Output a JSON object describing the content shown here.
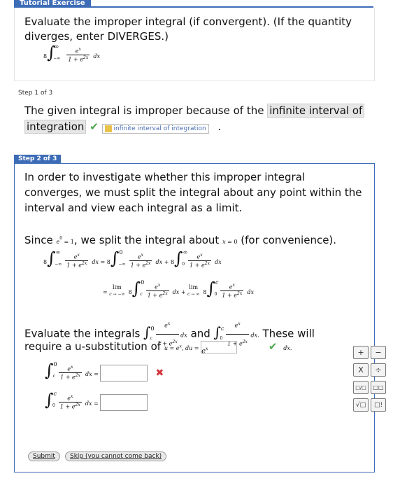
{
  "tutorial": {
    "tab_label": "Tutorial Exercise",
    "question": "Evaluate the improper integral (if convergent). (If the quantity diverges, enter DIVERGES.)"
  },
  "step1": {
    "label": "Step 1 of 3",
    "text_before": "The given integral is improper because of the",
    "answer_highlight_line1": "infinite interval of",
    "answer_highlight_line2": "integration",
    "answer_key": "infinite interval of integration",
    "period": "."
  },
  "step2": {
    "label": "Step 2 of 3",
    "paragraph": "In order to investigate whether this improper integral converges, we must split the integral about any point within the interval and view each integral as a limit.",
    "since_prefix": "Since",
    "since_mid": ", we split the integral about",
    "since_suffix": "(for convenience).",
    "evaluate_prefix": "Evaluate the integrals",
    "and_text": "and",
    "these_will": "These will",
    "require_text": "require a u-substitution of",
    "du_answer": "e",
    "du_suffix": "dx."
  },
  "keypad": [
    "+",
    "−",
    "X",
    "÷",
    "□/□",
    "□□",
    "√□",
    "□!"
  ],
  "buttons": {
    "submit": "Submit",
    "skip": "Skip (you cannot come back)"
  },
  "colors": {
    "accent": "#3d6cb7",
    "correct": "#4ca64c",
    "incorrect": "#d0333b"
  }
}
